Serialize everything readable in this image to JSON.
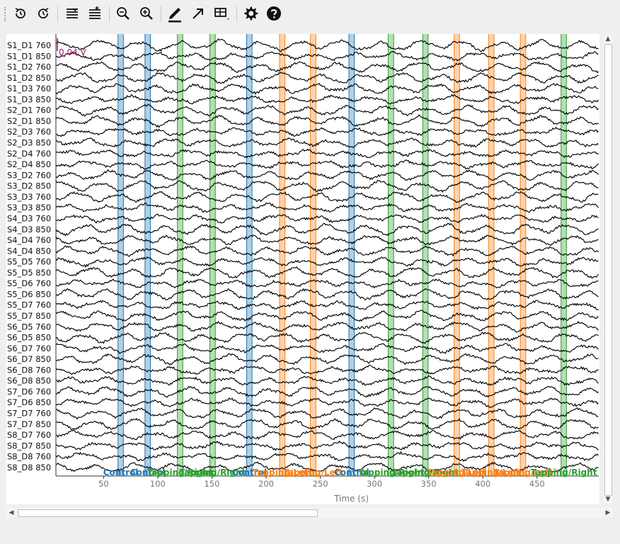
{
  "toolbar": {
    "items": [
      {
        "name": "reset-view-icon",
        "label": "Reset view"
      },
      {
        "name": "reset-time-icon",
        "label": "Reset time"
      },
      {
        "name": "fewer-channels-icon",
        "label": "Fewer channels"
      },
      {
        "name": "more-channels-icon",
        "label": "More channels"
      },
      {
        "name": "zoom-out-icon",
        "label": "Zoom out"
      },
      {
        "name": "zoom-in-icon",
        "label": "Zoom in"
      },
      {
        "name": "annotate-pen-icon",
        "label": "Annotation mode"
      },
      {
        "name": "arrow-icon",
        "label": "Arrow"
      },
      {
        "name": "overview-grid-icon",
        "label": "Overview"
      },
      {
        "name": "settings-gear-icon",
        "label": "Settings"
      },
      {
        "name": "help-icon",
        "label": "Help"
      }
    ]
  },
  "chart_data": {
    "type": "line",
    "xlabel": "Time (s)",
    "xlim": [
      6,
      507
    ],
    "x_ticks": [
      50,
      100,
      150,
      200,
      250,
      300,
      350,
      400,
      450
    ],
    "scale_label": "0.04 V",
    "grid": false,
    "channels": [
      "S1_D1 760",
      "S1_D1 850",
      "S1_D2 760",
      "S1_D2 850",
      "S1_D3 760",
      "S1_D3 850",
      "S2_D1 760",
      "S2_D1 850",
      "S2_D3 760",
      "S2_D3 850",
      "S2_D4 760",
      "S2_D4 850",
      "S3_D2 760",
      "S3_D2 850",
      "S3_D3 760",
      "S3_D3 850",
      "S4_D3 760",
      "S4_D3 850",
      "S4_D4 760",
      "S4_D4 850",
      "S5_D5 760",
      "S5_D5 850",
      "S5_D6 760",
      "S5_D6 850",
      "S5_D7 760",
      "S5_D7 850",
      "S6_D5 760",
      "S6_D5 850",
      "S6_D7 760",
      "S6_D7 850",
      "S6_D8 760",
      "S6_D8 850",
      "S7_D6 760",
      "S7_D6 850",
      "S7_D7 760",
      "S7_D7 850",
      "S8_D7 760",
      "S8_D7 850",
      "S8_D8 760",
      "S8_D8 850"
    ],
    "annotation_colors": {
      "Control": "#1f77b4",
      "Tapping/Left": "#ff7f0e",
      "Tapping/Right": "#2ca02c"
    },
    "annotations": [
      {
        "onset": 63.3,
        "duration": 5,
        "type": "Control",
        "label": "Control"
      },
      {
        "onset": 88.2,
        "duration": 5,
        "type": "Control",
        "label": "Control"
      },
      {
        "onset": 118.1,
        "duration": 5,
        "type": "Tapping/Right",
        "label": "Tapping/Right"
      },
      {
        "onset": 148.1,
        "duration": 5,
        "type": "Tapping/Right",
        "label": "Tapping/Right"
      },
      {
        "onset": 182.0,
        "duration": 5,
        "type": "Control",
        "label": "Control"
      },
      {
        "onset": 212.4,
        "duration": 5,
        "type": "Tapping/Left",
        "label": "Tapping/Left"
      },
      {
        "onset": 240.9,
        "duration": 5,
        "type": "Tapping/Left",
        "label": "Tapping/Left"
      },
      {
        "onset": 276.4,
        "duration": 5,
        "type": "Control",
        "label": "Control"
      },
      {
        "onset": 312.7,
        "duration": 5,
        "type": "Tapping/Right",
        "label": "Tapping/Right"
      },
      {
        "onset": 344.5,
        "duration": 5,
        "type": "Tapping/Right",
        "label": "Tapping/Right"
      },
      {
        "onset": 373.5,
        "duration": 5,
        "type": "Tapping/Left",
        "label": "Tapping/Left"
      },
      {
        "onset": 405.3,
        "duration": 5,
        "type": "Tapping/Left",
        "label": "Tapping/Left"
      },
      {
        "onset": 434.6,
        "duration": 5,
        "type": "Tapping/Left",
        "label": "Tapping/Left"
      },
      {
        "onset": 472.2,
        "duration": 5,
        "type": "Tapping/Right",
        "label": "Tapping/Right"
      }
    ]
  }
}
